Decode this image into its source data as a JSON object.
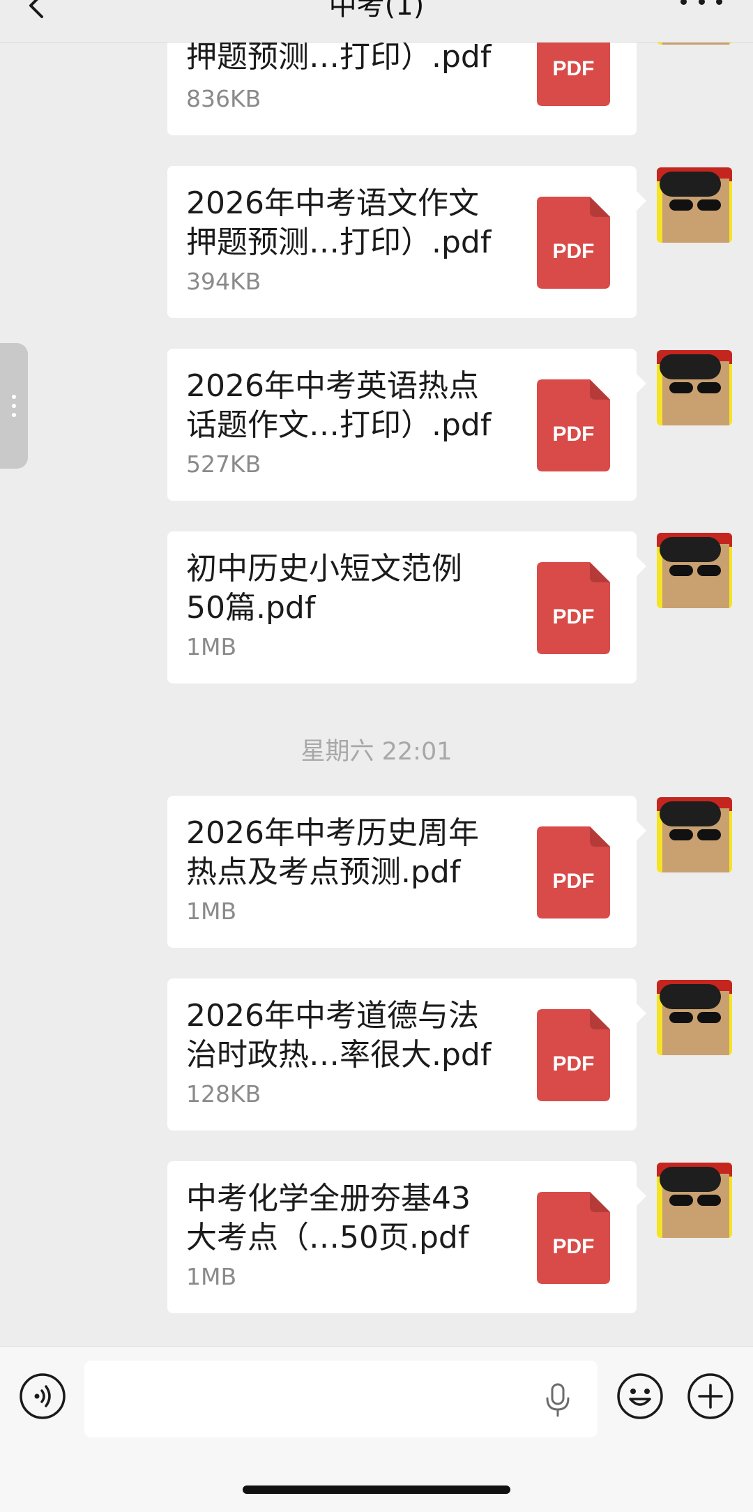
{
  "header": {
    "title": "中考(1)"
  },
  "messages": [
    {
      "name": "押题预测…打印）.pdf",
      "size": "836KB"
    },
    {
      "name": "2026年中考语文作文\n押题预测…打印）.pdf",
      "size": "394KB"
    },
    {
      "name": "2026年中考英语热点\n话题作文…打印）.pdf",
      "size": "527KB"
    },
    {
      "name": "初中历史小短文范例\n50篇.pdf",
      "size": "1MB"
    },
    {
      "name": "2026年中考历史周年\n热点及考点预测.pdf",
      "size": "1MB"
    },
    {
      "name": "2026年中考道德与法\n治时政热…率很大.pdf",
      "size": "128KB"
    },
    {
      "name": "中考化学全册夯基43\n大考点（…50页.pdf",
      "size": "1MB"
    }
  ],
  "time_label": "星期六 22:01",
  "pdf_label": "PDF",
  "icons": {
    "back": "chevron-left-icon",
    "more": "more-icon",
    "file": "pdf-file-icon",
    "voice": "voice-icon",
    "mic": "microphone-icon",
    "emoji": "emoji-icon",
    "plus": "plus-icon"
  },
  "colors": {
    "background": "#ededed",
    "bubble": "#ffffff",
    "pdf": "#d84b49",
    "pdf_fold": "#b53b39",
    "time": "#a8a8a8",
    "size_text": "#8a8a8a"
  }
}
